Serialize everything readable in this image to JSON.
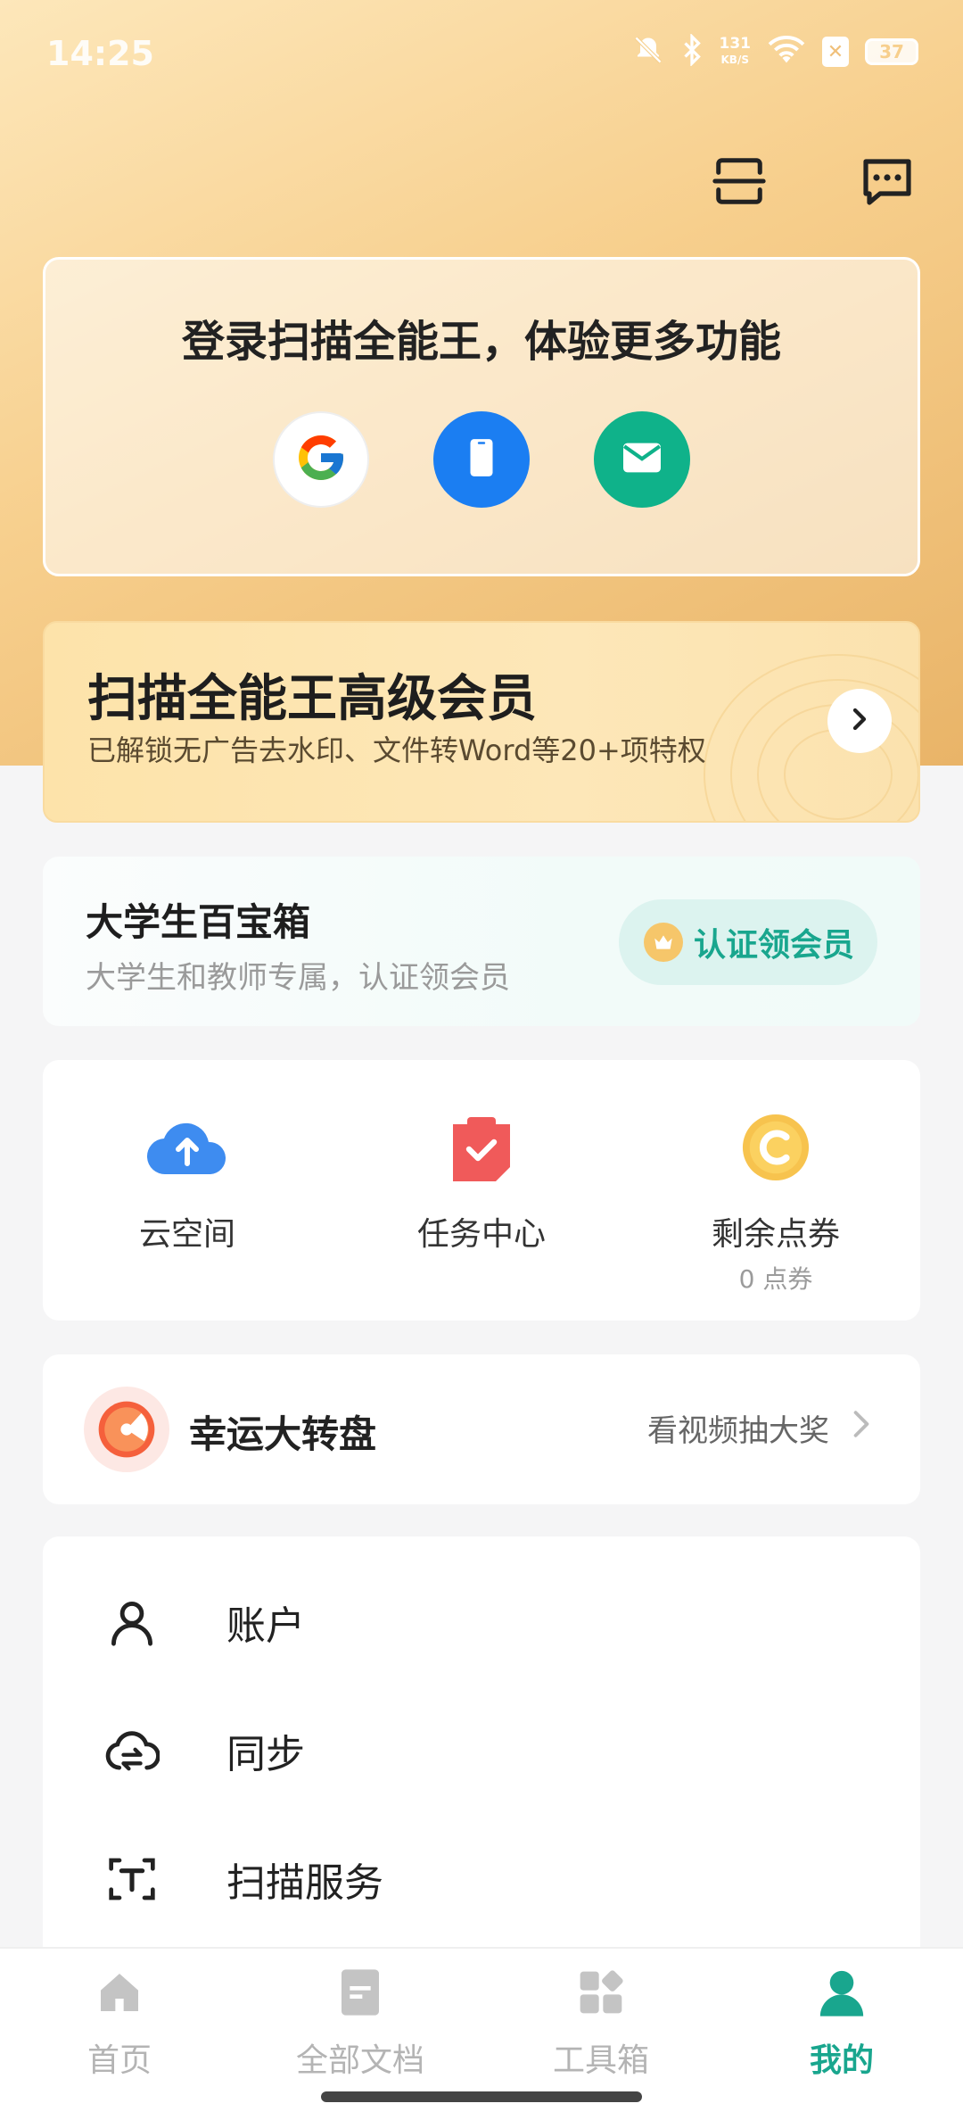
{
  "status_bar": {
    "time": "14:25",
    "net_speed_value": "131",
    "net_speed_unit": "KB/S",
    "battery": "37",
    "icons": [
      "mute-icon",
      "bluetooth-icon",
      "wifi-icon",
      "sim-off-icon",
      "battery-icon"
    ]
  },
  "header": {
    "actions": [
      "scan-icon",
      "message-icon"
    ]
  },
  "login": {
    "title": "登录扫描全能王，体验更多功能",
    "methods": [
      "google-icon",
      "phone-icon",
      "email-icon"
    ]
  },
  "vip": {
    "title": "扫描全能王高级会员",
    "subtitle": "已解锁无广告去水印、文件转Word等20+项特权"
  },
  "student": {
    "title": "大学生百宝箱",
    "subtitle": "大学生和教师专属，认证领会员",
    "button": "认证领会员"
  },
  "quick": [
    {
      "label": "云空间",
      "icon": "cloud-upload-icon"
    },
    {
      "label": "任务中心",
      "icon": "task-icon"
    },
    {
      "label": "剩余点券",
      "sub": "0 点券",
      "icon": "coin-icon"
    }
  ],
  "lucky": {
    "title": "幸运大转盘",
    "link": "看视频抽大奖"
  },
  "menu": [
    {
      "label": "账户",
      "icon": "user-icon"
    },
    {
      "label": "同步",
      "icon": "cloud-sync-icon"
    },
    {
      "label": "扫描服务",
      "icon": "text-scan-icon"
    }
  ],
  "nav": [
    {
      "label": "首页",
      "icon": "home-icon"
    },
    {
      "label": "全部文档",
      "icon": "document-icon"
    },
    {
      "label": "工具箱",
      "icon": "toolbox-icon"
    },
    {
      "label": "我的",
      "icon": "profile-icon",
      "active": true
    }
  ],
  "colors": {
    "accent": "#19a68e",
    "hero_gradient_start": "#fde7ba",
    "hero_gradient_end": "#e9b468",
    "google_bg": "#ffffff",
    "phone_bg": "#1b7ef2",
    "email_bg": "#0fb28a"
  }
}
